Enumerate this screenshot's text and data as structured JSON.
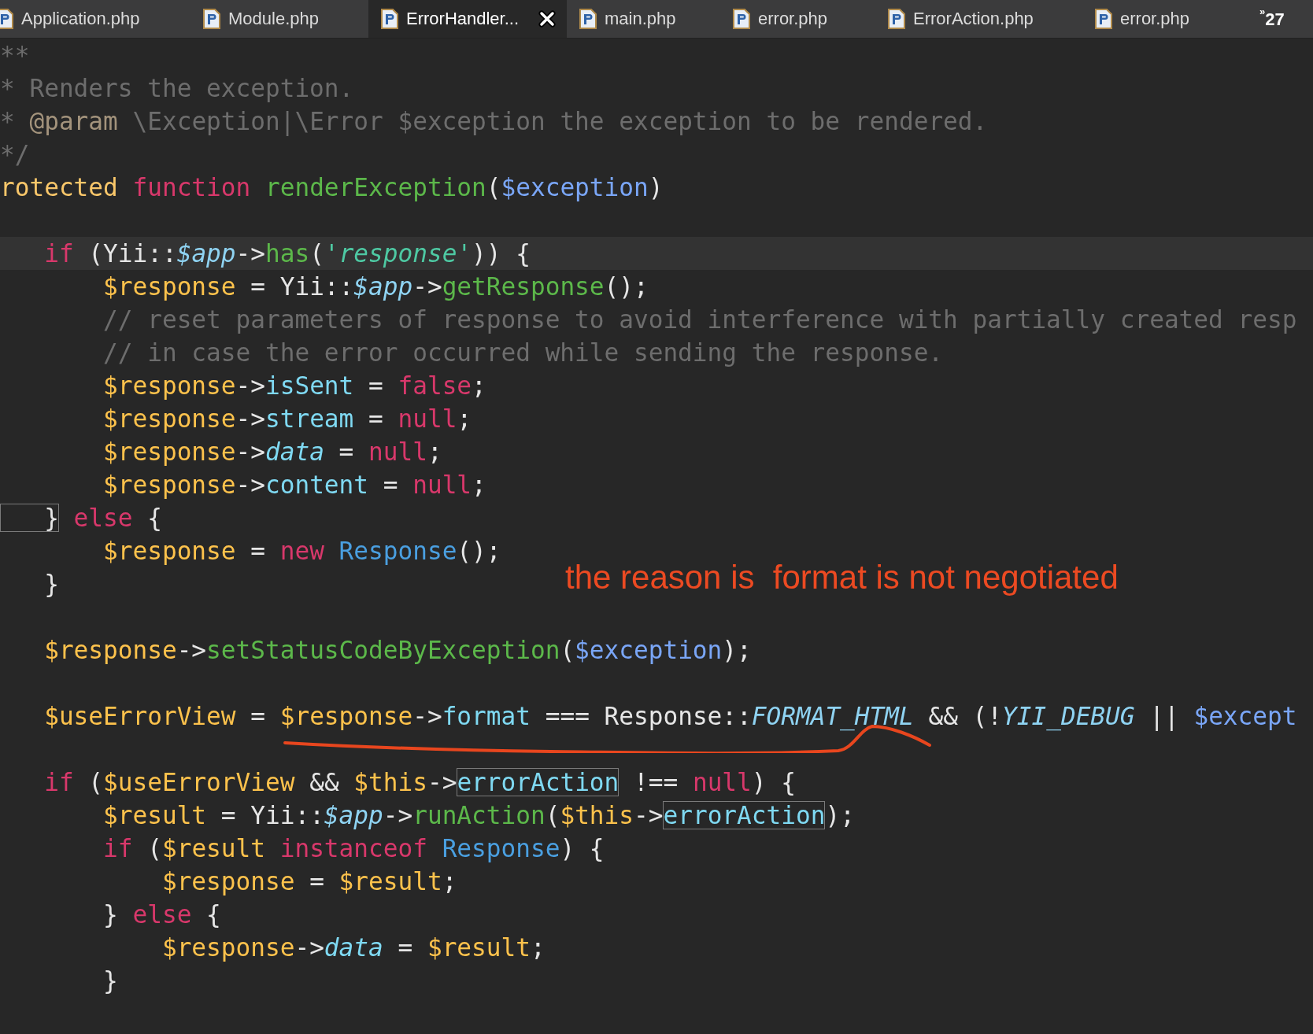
{
  "tabs": [
    {
      "label": "Application.php",
      "selected": false
    },
    {
      "label": "Module.php",
      "selected": false
    },
    {
      "label": "ErrorHandler...",
      "selected": true
    },
    {
      "label": "main.php",
      "selected": false
    },
    {
      "label": "error.php",
      "selected": false
    },
    {
      "label": "ErrorAction.php",
      "selected": false
    },
    {
      "label": "error.php",
      "selected": false
    }
  ],
  "tab_overflow": {
    "chevron": "»",
    "count": "27"
  },
  "lines": [
    {
      "current": false,
      "tokens": [
        {
          "text": "**",
          "kind": "comment"
        }
      ]
    },
    {
      "current": false,
      "tokens": [
        {
          "text": "* Renders the exception.",
          "kind": "comment"
        }
      ]
    },
    {
      "current": false,
      "tokens": [
        {
          "text": "* ",
          "kind": "comment"
        },
        {
          "text": "@param",
          "kind": "doctag"
        },
        {
          "text": " \\Exception|\\Error $exception the exception to be rendered.",
          "kind": "comment"
        }
      ]
    },
    {
      "current": false,
      "tokens": [
        {
          "text": "*/",
          "kind": "comment"
        }
      ]
    },
    {
      "current": false,
      "tokens": [
        {
          "text": "rotected",
          "kind": "storage"
        },
        {
          "text": " function",
          "kind": "keyword"
        },
        {
          "text": " renderException",
          "kind": "function"
        },
        {
          "text": "(",
          "kind": "plain"
        },
        {
          "text": "$exception",
          "kind": "param"
        },
        {
          "text": ")",
          "kind": "plain"
        }
      ]
    },
    {
      "kind": "blank"
    },
    {
      "current": true,
      "tokens": [
        {
          "text": "   if",
          "kind": "keyword"
        },
        {
          "text": " (Yii::",
          "kind": "plain"
        },
        {
          "text": "$app",
          "kind": "static"
        },
        {
          "text": "->",
          "kind": "plain"
        },
        {
          "text": "has",
          "kind": "function"
        },
        {
          "text": "(",
          "kind": "plain"
        },
        {
          "text": "'response'",
          "kind": "string"
        },
        {
          "text": ")) {",
          "kind": "plain"
        }
      ]
    },
    {
      "current": false,
      "tokens": [
        {
          "text": "       $response",
          "kind": "variable"
        },
        {
          "text": " = Yii::",
          "kind": "plain"
        },
        {
          "text": "$app",
          "kind": "static"
        },
        {
          "text": "->",
          "kind": "plain"
        },
        {
          "text": "getResponse",
          "kind": "function"
        },
        {
          "text": "();",
          "kind": "plain"
        }
      ]
    },
    {
      "current": false,
      "tokens": [
        {
          "text": "       // reset parameters of response to avoid interference with partially created resp",
          "kind": "comment"
        }
      ]
    },
    {
      "current": false,
      "tokens": [
        {
          "text": "       // in case the error occurred while sending the response.",
          "kind": "comment"
        }
      ]
    },
    {
      "current": false,
      "tokens": [
        {
          "text": "       $response",
          "kind": "variable"
        },
        {
          "text": "->",
          "kind": "plain"
        },
        {
          "text": "isSent",
          "kind": "property"
        },
        {
          "text": " = ",
          "kind": "plain"
        },
        {
          "text": "false",
          "kind": "keyword"
        },
        {
          "text": ";",
          "kind": "plain"
        }
      ]
    },
    {
      "current": false,
      "tokens": [
        {
          "text": "       $response",
          "kind": "variable"
        },
        {
          "text": "->",
          "kind": "plain"
        },
        {
          "text": "stream",
          "kind": "property"
        },
        {
          "text": " = ",
          "kind": "plain"
        },
        {
          "text": "null",
          "kind": "keyword"
        },
        {
          "text": ";",
          "kind": "plain"
        }
      ]
    },
    {
      "current": false,
      "tokens": [
        {
          "text": "       $response",
          "kind": "variable"
        },
        {
          "text": "->",
          "kind": "plain"
        },
        {
          "text": "data",
          "kind": "magic"
        },
        {
          "text": " = ",
          "kind": "plain"
        },
        {
          "text": "null",
          "kind": "keyword"
        },
        {
          "text": ";",
          "kind": "plain"
        }
      ]
    },
    {
      "current": false,
      "tokens": [
        {
          "text": "       $response",
          "kind": "variable"
        },
        {
          "text": "->",
          "kind": "plain"
        },
        {
          "text": "content",
          "kind": "property"
        },
        {
          "text": " = ",
          "kind": "plain"
        },
        {
          "text": "null",
          "kind": "keyword"
        },
        {
          "text": ";",
          "kind": "plain"
        }
      ]
    },
    {
      "current": false,
      "tokens": [
        {
          "text": "   }",
          "kind": "plain",
          "boxed": true
        },
        {
          "text": " else",
          "kind": "keyword"
        },
        {
          "text": " {",
          "kind": "plain"
        }
      ]
    },
    {
      "current": false,
      "tokens": [
        {
          "text": "       $response",
          "kind": "variable"
        },
        {
          "text": " = ",
          "kind": "plain"
        },
        {
          "text": "new",
          "kind": "keyword"
        },
        {
          "text": " Response",
          "kind": "class"
        },
        {
          "text": "();",
          "kind": "plain"
        }
      ]
    },
    {
      "current": false,
      "tokens": [
        {
          "text": "   }",
          "kind": "plain"
        }
      ]
    },
    {
      "kind": "blank"
    },
    {
      "current": false,
      "tokens": [
        {
          "text": "   $response",
          "kind": "variable"
        },
        {
          "text": "->",
          "kind": "plain"
        },
        {
          "text": "setStatusCodeByException",
          "kind": "function"
        },
        {
          "text": "(",
          "kind": "plain"
        },
        {
          "text": "$exception",
          "kind": "param"
        },
        {
          "text": ");",
          "kind": "plain"
        }
      ]
    },
    {
      "kind": "blank"
    },
    {
      "current": false,
      "tokens": [
        {
          "text": "   $useErrorView",
          "kind": "variable"
        },
        {
          "text": " = ",
          "kind": "plain"
        },
        {
          "text": "$response",
          "kind": "variable"
        },
        {
          "text": "->",
          "kind": "plain"
        },
        {
          "text": "format",
          "kind": "property"
        },
        {
          "text": " === Response::",
          "kind": "plain"
        },
        {
          "text": "FORMAT_HTML",
          "kind": "static"
        },
        {
          "text": " && (!",
          "kind": "plain"
        },
        {
          "text": "YII_DEBUG",
          "kind": "static"
        },
        {
          "text": " || ",
          "kind": "plain"
        },
        {
          "text": "$except",
          "kind": "param"
        }
      ]
    },
    {
      "kind": "blank"
    },
    {
      "current": false,
      "tokens": [
        {
          "text": "   if",
          "kind": "keyword"
        },
        {
          "text": " (",
          "kind": "plain"
        },
        {
          "text": "$useErrorView",
          "kind": "variable"
        },
        {
          "text": " && ",
          "kind": "plain"
        },
        {
          "text": "$this",
          "kind": "variable"
        },
        {
          "text": "->",
          "kind": "plain"
        },
        {
          "text": "errorAction",
          "kind": "property",
          "boxed": true
        },
        {
          "text": " !== ",
          "kind": "plain"
        },
        {
          "text": "null",
          "kind": "keyword"
        },
        {
          "text": ") {",
          "kind": "plain"
        }
      ]
    },
    {
      "current": false,
      "tokens": [
        {
          "text": "       $result",
          "kind": "variable"
        },
        {
          "text": " = Yii::",
          "kind": "plain"
        },
        {
          "text": "$app",
          "kind": "static"
        },
        {
          "text": "->",
          "kind": "plain"
        },
        {
          "text": "runAction",
          "kind": "function"
        },
        {
          "text": "(",
          "kind": "plain"
        },
        {
          "text": "$this",
          "kind": "variable"
        },
        {
          "text": "->",
          "kind": "plain"
        },
        {
          "text": "errorAction",
          "kind": "property",
          "boxed": true
        },
        {
          "text": ");",
          "kind": "plain"
        }
      ]
    },
    {
      "current": false,
      "tokens": [
        {
          "text": "       if",
          "kind": "keyword"
        },
        {
          "text": " (",
          "kind": "plain"
        },
        {
          "text": "$result",
          "kind": "variable"
        },
        {
          "text": " instanceof",
          "kind": "keyword"
        },
        {
          "text": " Response",
          "kind": "class"
        },
        {
          "text": ") {",
          "kind": "plain"
        }
      ]
    },
    {
      "current": false,
      "tokens": [
        {
          "text": "           $response",
          "kind": "variable"
        },
        {
          "text": " = ",
          "kind": "plain"
        },
        {
          "text": "$result",
          "kind": "variable"
        },
        {
          "text": ";",
          "kind": "plain"
        }
      ]
    },
    {
      "current": false,
      "tokens": [
        {
          "text": "       } ",
          "kind": "plain"
        },
        {
          "text": "else",
          "kind": "keyword"
        },
        {
          "text": " {",
          "kind": "plain"
        }
      ]
    },
    {
      "current": false,
      "tokens": [
        {
          "text": "           $response",
          "kind": "variable"
        },
        {
          "text": "->",
          "kind": "plain"
        },
        {
          "text": "data",
          "kind": "magic"
        },
        {
          "text": " = ",
          "kind": "plain"
        },
        {
          "text": "$result",
          "kind": "variable"
        },
        {
          "text": ";",
          "kind": "plain"
        }
      ]
    },
    {
      "current": false,
      "tokens": [
        {
          "text": "       }",
          "kind": "plain"
        }
      ]
    }
  ],
  "annotation": {
    "text": "the reason is  format is not negotiated"
  }
}
